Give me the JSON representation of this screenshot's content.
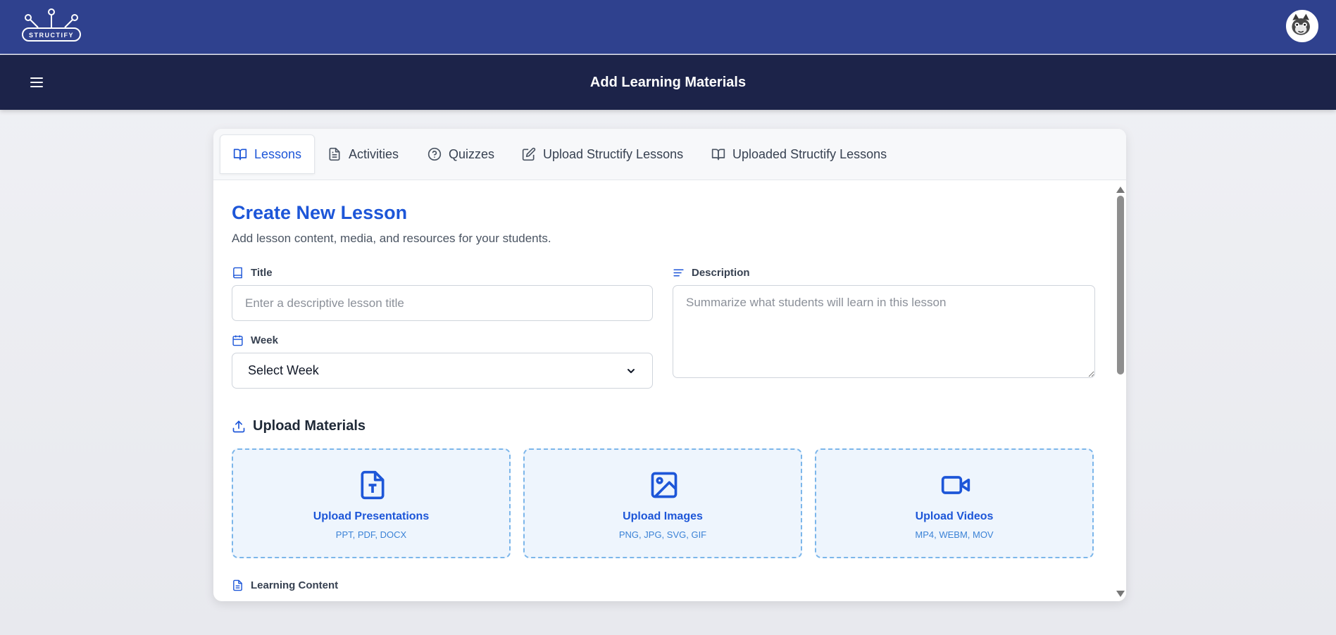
{
  "app": {
    "logo_text": "STRUCTIFY",
    "page_title": "Add Learning Materials"
  },
  "colors": {
    "topbar": "#2f418e",
    "subheader": "#1c2349",
    "accent": "#1d56d8",
    "drop_border": "#7cb6ea",
    "drop_bg": "#eef5fd"
  },
  "tabs": [
    {
      "label": "Lessons",
      "icon": "book-open-icon",
      "active": true
    },
    {
      "label": "Activities",
      "icon": "document-icon",
      "active": false
    },
    {
      "label": "Quizzes",
      "icon": "question-circle-icon",
      "active": false
    },
    {
      "label": "Upload Structify Lessons",
      "icon": "edit-icon",
      "active": false
    },
    {
      "label": "Uploaded Structify Lessons",
      "icon": "book-open-icon",
      "active": false
    }
  ],
  "form": {
    "heading": "Create New Lesson",
    "subtext": "Add lesson content, media, and resources for your students.",
    "title_label": "Title",
    "title_placeholder": "Enter a descriptive lesson title",
    "title_value": "",
    "description_label": "Description",
    "description_placeholder": "Summarize what students will learn in this lesson",
    "description_value": "",
    "week_label": "Week",
    "week_selected": "Select Week",
    "upload_heading": "Upload Materials",
    "uploads": [
      {
        "title": "Upload Presentations",
        "formats": "PPT, PDF, DOCX",
        "icon": "file-text-icon"
      },
      {
        "title": "Upload Images",
        "formats": "PNG, JPG, SVG, GIF",
        "icon": "image-icon"
      },
      {
        "title": "Upload Videos",
        "formats": "MP4, WEBM, MOV",
        "icon": "video-icon"
      }
    ],
    "learning_content_label": "Learning Content"
  }
}
